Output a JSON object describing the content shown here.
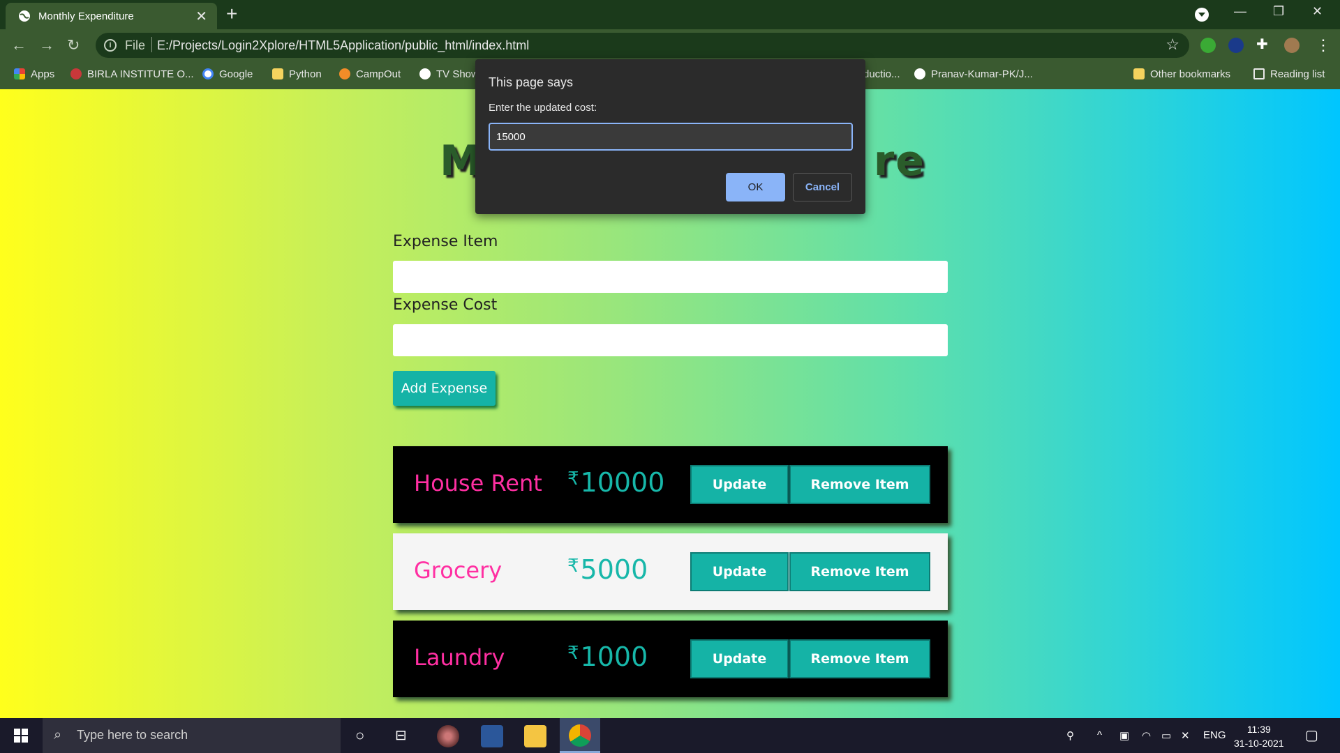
{
  "browser": {
    "tab_title": "Monthly Expenditure",
    "url_scheme": "File",
    "url": "E:/Projects/Login2Xplore/HTML5Application/public_html/index.html",
    "bookmarks": [
      {
        "label": "Apps",
        "icon": "apps-grid-icon"
      },
      {
        "label": "BIRLA INSTITUTE O...",
        "icon": "bit-logo-icon"
      },
      {
        "label": "Google",
        "icon": "google-icon"
      },
      {
        "label": "Python",
        "icon": "folder-icon"
      },
      {
        "label": "CampOut",
        "icon": "campfire-icon"
      },
      {
        "label": "TV Show",
        "icon": "globe-icon"
      },
      {
        "label": "ductio...",
        "icon": "globe-icon"
      },
      {
        "label": "Pranav-Kumar-PK/J...",
        "icon": "github-icon"
      }
    ],
    "other_bookmarks": "Other bookmarks",
    "reading_list": "Reading list"
  },
  "page": {
    "heading_left": "M",
    "heading_right": "re",
    "expense_item_label": "Expense Item",
    "expense_cost_label": "Expense Cost",
    "add_button": "Add Expense",
    "currency_symbol": "₹",
    "update_label": "Update",
    "remove_label": "Remove Item",
    "expenses": [
      {
        "name": "House Rent",
        "cost": "10000",
        "theme": "dark"
      },
      {
        "name": "Grocery",
        "cost": "5000",
        "theme": "light"
      },
      {
        "name": "Laundry",
        "cost": "1000",
        "theme": "dark"
      }
    ]
  },
  "dialog": {
    "title": "This page says",
    "prompt": "Enter the updated cost:",
    "input_value": "15000",
    "ok": "OK",
    "cancel": "Cancel"
  },
  "taskbar": {
    "search_placeholder": "Type here to search",
    "language": "ENG",
    "time": "11:39",
    "date": "31-10-2021"
  },
  "colors": {
    "accent_teal": "#15b3a6",
    "item_pink": "#ff2fa2",
    "dialog_blue": "#8ab4f8"
  }
}
